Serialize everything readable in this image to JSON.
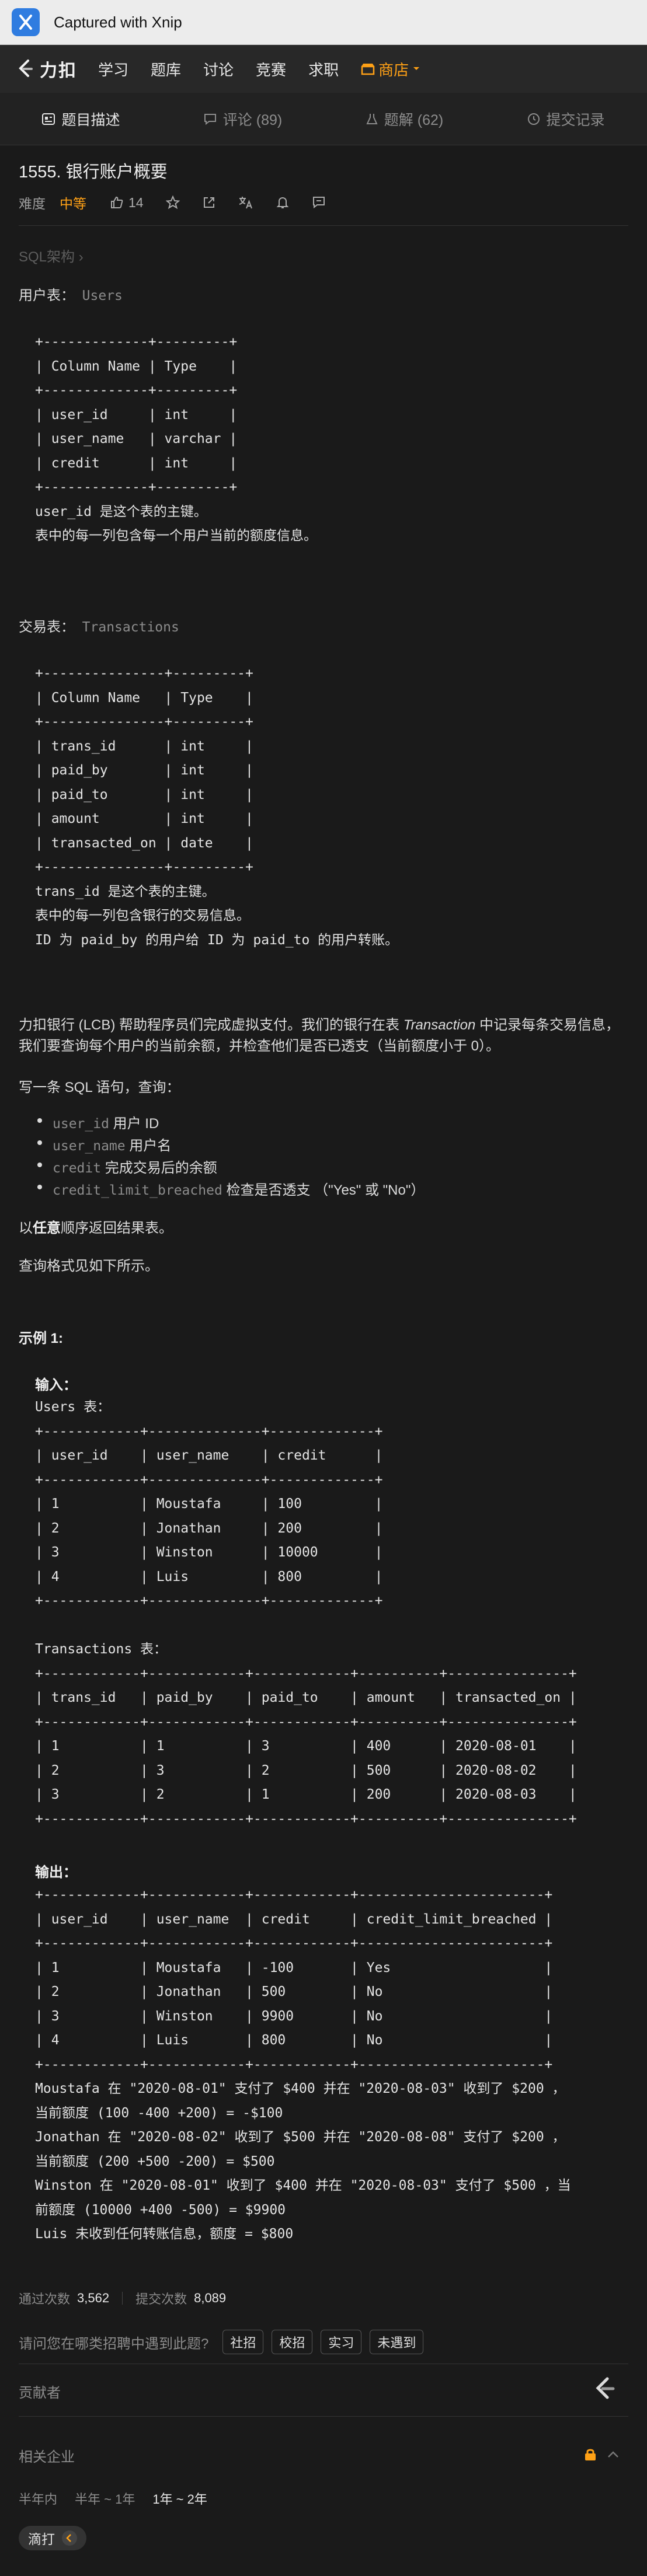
{
  "window": {
    "title": "Captured with Xnip",
    "app_icon": "xnip-scissors-icon"
  },
  "navbar": {
    "logo_text": "力扣",
    "items": [
      "学习",
      "题库",
      "讨论",
      "竞赛",
      "求职"
    ],
    "store_label": "商店",
    "accent": "#ffa116"
  },
  "tabs": [
    {
      "label": "题目描述",
      "icon": "description-icon"
    },
    {
      "label": "评论 (89)",
      "icon": "comment-icon"
    },
    {
      "label": "题解 (62)",
      "icon": "solution-flask-icon"
    },
    {
      "label": "提交记录",
      "icon": "history-clock-icon"
    }
  ],
  "problem": {
    "title": "1555. 银行账户概要",
    "difficulty_label": "难度",
    "difficulty": "中等",
    "likes": "14"
  },
  "breadcrumb": "SQL架构 ›",
  "users_heading": {
    "label": "用户表：",
    "table": "Users"
  },
  "users_schema": "+-------------+---------+\n| Column Name | Type    |\n+-------------+---------+\n| user_id     | int     |\n| user_name   | varchar |\n| credit      | int     |\n+-------------+---------+\nuser_id 是这个表的主键。\n表中的每一列包含每一个用户当前的额度信息。",
  "trans_heading": {
    "label": "交易表：",
    "table": "Transactions"
  },
  "trans_schema": "+---------------+---------+\n| Column Name   | Type    |\n+---------------+---------+\n| trans_id      | int     |\n| paid_by       | int     |\n| paid_to       | int     |\n| amount        | int     |\n| transacted_on | date    |\n+---------------+---------+\ntrans_id 是这个表的主键。\n表中的每一列包含银行的交易信息。\nID 为 paid_by 的用户给 ID 为 paid_to 的用户转账。",
  "description": {
    "p1_before": "力扣银行 (LCB) 帮助程序员们完成虚拟支付。我们的银行在表 ",
    "p1_italic": "Transaction",
    "p1_after": " 中记录每条交易信息，我们要查询每个用户的当前余额，并检查他们是否已透支（当前额度小于 0）。",
    "p2": "写一条 SQL 语句，查询：",
    "bullets": [
      {
        "code": "user_id",
        "text": " 用户 ID"
      },
      {
        "code": "user_name",
        "text": " 用户名"
      },
      {
        "code": "credit",
        "text": " 完成交易后的余额"
      },
      {
        "code": "credit_limit_breached",
        "text": " 检查是否透支 （\"Yes\" 或 \"No\"）"
      }
    ],
    "p3_before": "以",
    "p3_bold": "任意",
    "p3_after": "顺序返回结果表。",
    "p4": "查询格式见如下所示。"
  },
  "example": {
    "heading": "示例 1:",
    "input_label": "输入：",
    "input_block": "Users 表：\n+------------+--------------+-------------+\n| user_id    | user_name    | credit      |\n+------------+--------------+-------------+\n| 1          | Moustafa     | 100         |\n| 2          | Jonathan     | 200         |\n| 3          | Winston      | 10000       |\n| 4          | Luis         | 800         |\n+------------+--------------+-------------+\n\nTransactions 表：\n+------------+------------+------------+----------+---------------+\n| trans_id   | paid_by    | paid_to    | amount   | transacted_on |\n+------------+------------+------------+----------+---------------+\n| 1          | 1          | 3          | 400      | 2020-08-01    |\n| 2          | 3          | 2          | 500      | 2020-08-02    |\n| 3          | 2          | 1          | 200      | 2020-08-03    |\n+------------+------------+------------+----------+---------------+",
    "output_label": "输出：",
    "output_block": "+------------+------------+------------+-----------------------+\n| user_id    | user_name  | credit     | credit_limit_breached |\n+------------+------------+------------+-----------------------+\n| 1          | Moustafa   | -100       | Yes                   |\n| 2          | Jonathan   | 500        | No                    |\n| 3          | Winston    | 9900       | No                    |\n| 4          | Luis       | 800        | No                    |\n+------------+------------+------------+-----------------------+\nMoustafa 在 \"2020-08-01\" 支付了 $400 并在 \"2020-08-03\" 收到了 $200 ，\n当前额度 (100 -400 +200) = -$100\nJonathan 在 \"2020-08-02\" 收到了 $500 并在 \"2020-08-08\" 支付了 $200 ，\n当前额度 (200 +500 -200) = $500\nWinston 在 \"2020-08-01\" 收到了 $400 并在 \"2020-08-03\" 支付了 $500 ，当\n前额度 (10000 +400 -500) = $9900\nLuis 未收到任何转账信息，额度 = $800"
  },
  "stats": {
    "pass_label": "通过次数",
    "pass_value": "3,562",
    "submit_label": "提交次数",
    "submit_value": "8,089"
  },
  "survey": {
    "question": "请问您在哪类招聘中遇到此题?",
    "options": [
      "社招",
      "校招",
      "实习",
      "未遇到"
    ]
  },
  "contributors_label": "贡献者",
  "companies_label": "相关企业",
  "periods": [
    "半年内",
    "半年 ~ 1年",
    "1年 ~ 2年"
  ],
  "company_tag": "滴打"
}
